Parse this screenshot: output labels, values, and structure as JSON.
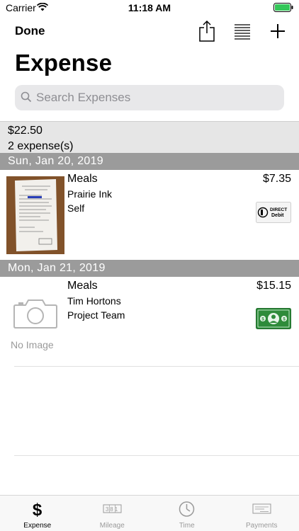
{
  "status": {
    "carrier": "Carrier",
    "time": "11:18 AM"
  },
  "nav": {
    "done_label": "Done",
    "title": "Expense"
  },
  "search": {
    "placeholder": "Search Expenses"
  },
  "summary": {
    "total": "$22.50",
    "count": "2 expense(s)"
  },
  "groups": [
    {
      "date": "Sun, Jan 20, 2019",
      "item": {
        "category": "Meals",
        "vendor": "Prairie Ink",
        "payer": "Self",
        "amount": "$7.35",
        "payment_icon": "direct-debit-icon",
        "payment_text": [
          "DIRECT",
          "Debit"
        ]
      }
    },
    {
      "date": "Mon, Jan 21, 2019",
      "item": {
        "category": "Meals",
        "vendor": "Tim Hortons",
        "payer": "Project Team",
        "amount": "$15.15",
        "payment_icon": "cash-icon",
        "no_image_label": "No Image"
      }
    }
  ],
  "tabs": [
    {
      "label": "Expense",
      "icon": "dollar-icon",
      "active": true
    },
    {
      "label": "Mileage",
      "icon": "odometer-icon",
      "odometer": "381",
      "active": false
    },
    {
      "label": "Time",
      "icon": "clock-icon",
      "active": false
    },
    {
      "label": "Payments",
      "icon": "check-icon",
      "active": false
    }
  ],
  "colors": {
    "header_gray": "#9b9b9b",
    "summary_bg": "#e6e6e6",
    "cash_green": "#2e8b3a",
    "search_bg": "#e8e8ea"
  }
}
